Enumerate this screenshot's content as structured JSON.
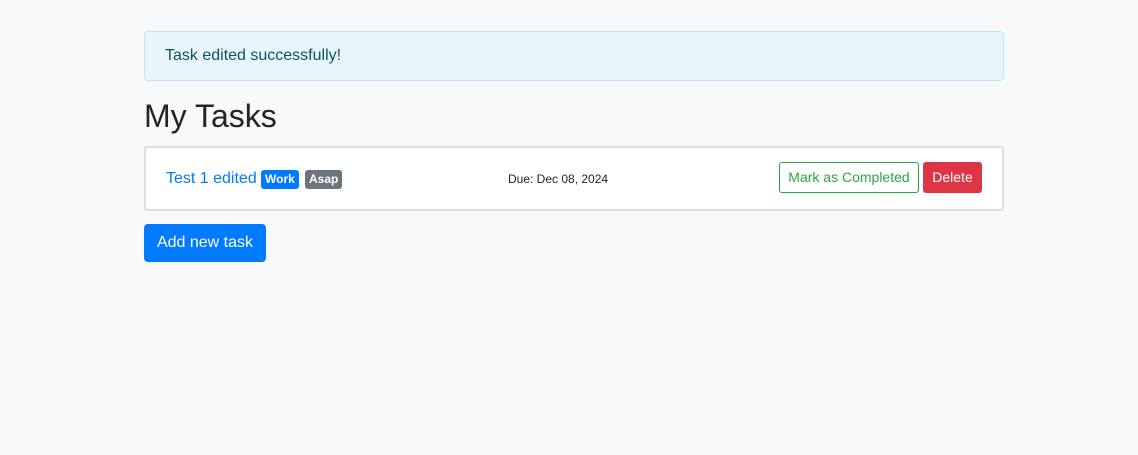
{
  "alert": {
    "message": "Task edited successfully!"
  },
  "page": {
    "title": "My Tasks"
  },
  "tasks": [
    {
      "title": "Test 1 edited",
      "tags": [
        "Work",
        "Asap"
      ],
      "due": "Due: Dec 08, 2024",
      "complete_label": "Mark as Completed",
      "delete_label": "Delete"
    }
  ],
  "actions": {
    "add_label": "Add new task"
  },
  "colors": {
    "primary": "#007bff",
    "secondary": "#6c757d",
    "success": "#28a745",
    "danger": "#dc3545",
    "info_bg": "#e8f6fb",
    "info_text": "#0c5460",
    "page_bg": "#f8f9fa"
  }
}
